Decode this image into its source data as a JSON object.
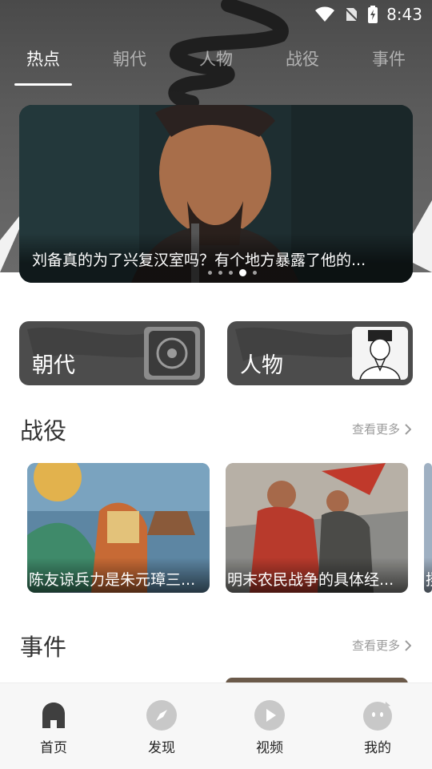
{
  "status_bar": {
    "time": "8:43"
  },
  "tabs": [
    {
      "label": "热点",
      "active": true
    },
    {
      "label": "朝代",
      "active": false
    },
    {
      "label": "人物",
      "active": false
    },
    {
      "label": "战役",
      "active": false
    },
    {
      "label": "事件",
      "active": false
    }
  ],
  "banner": {
    "text": "刘备真的为了兴复汉室吗？有个地方暴露了他的...",
    "dot_count": 5,
    "active_dot": 4
  },
  "categories": [
    {
      "label": "朝代"
    },
    {
      "label": "人物"
    }
  ],
  "battles": {
    "title": "战役",
    "see_more": "查看更多",
    "items": [
      {
        "text": "陈友谅兵力是朱元璋三..."
      },
      {
        "text": "明末农民战争的具体经..."
      },
      {
        "text": "揆"
      }
    ]
  },
  "events": {
    "title": "事件",
    "see_more": "查看更多"
  },
  "bottom_nav": [
    {
      "label": "首页",
      "icon": "home-icon",
      "active": true
    },
    {
      "label": "发现",
      "icon": "compass-icon",
      "active": false
    },
    {
      "label": "视频",
      "icon": "play-icon",
      "active": false
    },
    {
      "label": "我的",
      "icon": "profile-icon",
      "active": false
    }
  ],
  "colors": {
    "header_bg": "#4a4a4a",
    "nav_bg": "#f7f7f7",
    "title_text": "#333333",
    "muted_text": "#9a9a9a"
  }
}
